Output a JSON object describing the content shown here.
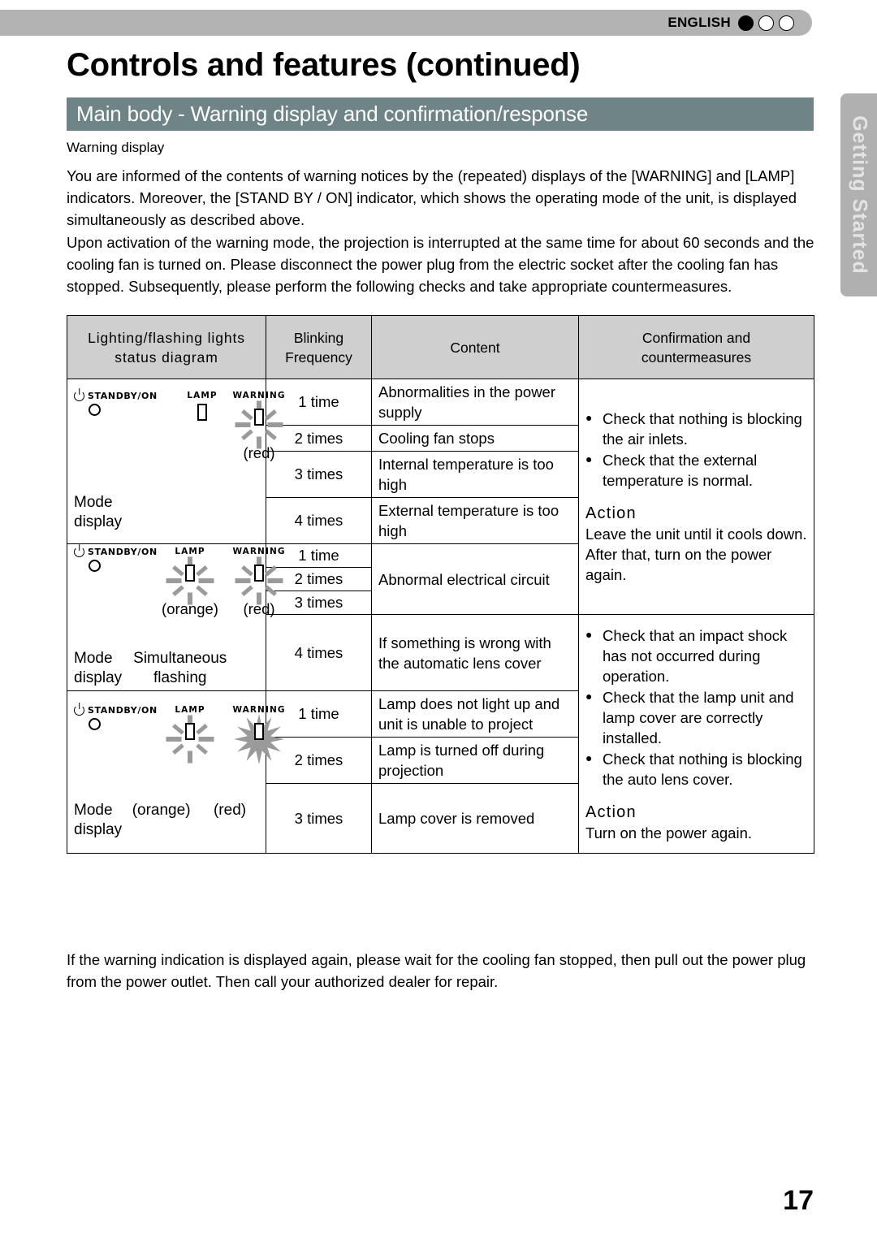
{
  "header": {
    "language": "ENGLISH",
    "indicator_dots": [
      "filled",
      "hollow",
      "hollow"
    ]
  },
  "page_title": "Controls and features (continued)",
  "section_bar": {
    "title": "Main body - Warning display and confirmation/response",
    "color": "#6f8487"
  },
  "side_tab": {
    "label": "Getting Started",
    "color": "#b0b0b0"
  },
  "subhead": "Warning display",
  "paragraphs": {
    "p1": "You are informed of the contents of warning notices by the (repeated) displays of the [WARNING] and [LAMP] indicators. Moreover, the [STAND BY / ON] indicator, which shows the operating mode of the unit, is displayed simultaneously as described above.",
    "p2": "Upon activation of the warning mode, the projection is interrupted at the same time for about 60 seconds and the cooling fan is turned on. Please disconnect the power plug from the electric socket after the cooling fan has stopped. Subsequently, please perform the following checks and take appropriate countermeasures.",
    "bottom": "If the warning indication is displayed again, please wait for the cooling fan stopped, then pull out the power plug from the power outlet.  Then call your authorized dealer for repair."
  },
  "table": {
    "headers": [
      "Lighting/flashing lights status diagram",
      "Blinking Frequency",
      "Content",
      "Confirmation and countermeasures"
    ],
    "header_lines": {
      "h1_line1": "Lighting/flashing lights",
      "h1_line2": "status diagram",
      "h2_line1": "Blinking",
      "h2_line2": "Frequency",
      "h3": "Content",
      "h4_line1": "Confirmation and",
      "h4_line2": "countermeasures"
    },
    "groups": [
      {
        "diagram": {
          "standby_label": "STANDBY/ON",
          "lamp_label": "LAMP",
          "warning_label": "WARNING",
          "lamp_state": "off",
          "warning_state": "flashing",
          "lamp_color_note": "",
          "warning_color_note": "(red)",
          "mode_line1": "Mode",
          "mode_line2": "display",
          "sim_line1": "",
          "sim_line2": ""
        },
        "rows": [
          {
            "frequency": "1 time",
            "content": "Abnormalities in the power supply"
          },
          {
            "frequency": "2 times",
            "content": "Cooling fan stops"
          },
          {
            "frequency": "3 times",
            "content": "Internal temperature is too high"
          },
          {
            "frequency": "4 times",
            "content": "External temperature is too high"
          }
        ]
      },
      {
        "diagram": {
          "standby_label": "STANDBY/ON",
          "lamp_label": "LAMP",
          "warning_label": "WARNING",
          "lamp_state": "flashing",
          "warning_state": "flashing",
          "lamp_color_note": "(orange)",
          "warning_color_note": "(red)",
          "mode_line1": "Mode",
          "mode_line2": "display",
          "sim_line1": "Simultaneous",
          "sim_line2": "flashing"
        },
        "rows": [
          {
            "frequency": "1 time",
            "content": "Abnormal electrical circuit"
          },
          {
            "frequency": "2 times",
            "content": ""
          },
          {
            "frequency": "3 times",
            "content": ""
          },
          {
            "frequency": "4 times",
            "content": "If something is wrong with the automatic lens cover"
          }
        ]
      },
      {
        "diagram": {
          "standby_label": "STANDBY/ON",
          "lamp_label": "LAMP",
          "warning_label": "WARNING",
          "lamp_state": "flashing",
          "warning_state": "lit",
          "lamp_color_note": "(orange)",
          "warning_color_note": "(red)",
          "mode_line1": "Mode",
          "mode_line2": "display",
          "sim_line1": "",
          "sim_line2": ""
        },
        "rows": [
          {
            "frequency": "1 time",
            "content": "Lamp does not light up and unit is unable to project"
          },
          {
            "frequency": "2 times",
            "content": "Lamp is turned off during projection"
          },
          {
            "frequency": "3 times",
            "content": "Lamp cover is removed"
          }
        ]
      }
    ],
    "countermeasures": [
      {
        "bullets": [
          "Check that nothing is blocking the air inlets.",
          "Check that the external temperature is normal."
        ],
        "action_heading": "Action",
        "action_text": "Leave the unit until it cools down.\nAfter that, turn on the power again."
      },
      {
        "bullets": [
          "Check that an impact shock has not occurred during operation.",
          "Check that the lamp unit and lamp cover are correctly installed.",
          "Check that nothing is blocking the auto lens cover."
        ],
        "action_heading": "Action",
        "action_text": "Turn on the power again."
      }
    ]
  },
  "page_number": "17"
}
